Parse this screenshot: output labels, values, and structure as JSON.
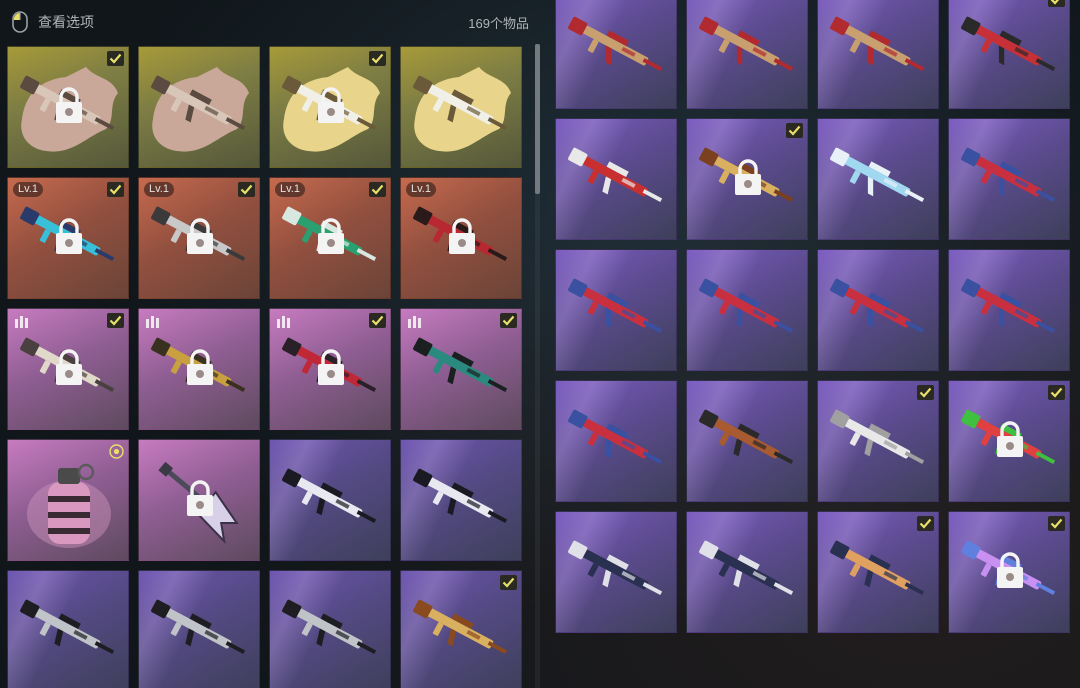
{
  "header": {
    "title": "查看选项",
    "count": "169个物品",
    "icon": "mouse-icon"
  },
  "colors": {
    "yellow": "#a79a39",
    "red": "#c66a4e",
    "pink": "#c77bc0",
    "purple": "#6d55b0",
    "check": "#e8e06a"
  },
  "left_items": [
    {
      "rarity": "yellow",
      "art": "rifle-cream",
      "splash": "#c9a89a",
      "locked": true,
      "checked": true
    },
    {
      "rarity": "yellow",
      "art": "rifle-cream",
      "splash": "#c9a89a",
      "locked": false,
      "checked": false
    },
    {
      "rarity": "yellow",
      "art": "rifle-white",
      "splash": "#e8d48a",
      "locked": true,
      "checked": true
    },
    {
      "rarity": "yellow",
      "art": "rifle-white",
      "splash": "#e8d48a",
      "locked": false,
      "checked": false
    },
    {
      "rarity": "red",
      "art": "smg-cyan",
      "level": "Lv.1",
      "locked": true,
      "checked": true
    },
    {
      "rarity": "red",
      "art": "rifle-gray",
      "level": "Lv.1",
      "locked": true,
      "checked": true
    },
    {
      "rarity": "red",
      "art": "rifle-green",
      "level": "Lv.1",
      "locked": true,
      "checked": true
    },
    {
      "rarity": "red",
      "art": "shotgun-red",
      "level": "Lv.1",
      "locked": true,
      "checked": false
    },
    {
      "rarity": "pink",
      "art": "rifle-bone",
      "tier": true,
      "locked": true,
      "checked": true
    },
    {
      "rarity": "pink",
      "art": "rifle-gold",
      "tier": true,
      "locked": true,
      "checked": false
    },
    {
      "rarity": "pink",
      "art": "rifle-red",
      "tier": true,
      "locked": true,
      "checked": true
    },
    {
      "rarity": "pink",
      "art": "rifle-teal",
      "tier": true,
      "locked": false,
      "checked": true
    },
    {
      "rarity": "pink",
      "art": "grenade-pink",
      "target": true,
      "locked": false,
      "checked": false
    },
    {
      "rarity": "pink",
      "art": "guitar-axe",
      "locked": true,
      "checked": false
    },
    {
      "rarity": "purple",
      "art": "scar-white",
      "locked": false,
      "checked": false
    },
    {
      "rarity": "purple",
      "art": "scar-white",
      "locked": false,
      "checked": false
    },
    {
      "rarity": "purple",
      "art": "scar-gray",
      "locked": false,
      "checked": false
    },
    {
      "rarity": "purple",
      "art": "scar-gray",
      "locked": false,
      "checked": false
    },
    {
      "rarity": "purple",
      "art": "scar-gray",
      "locked": false,
      "checked": false
    },
    {
      "rarity": "purple",
      "art": "groza-gold",
      "locked": false,
      "checked": true
    }
  ],
  "right_items": [
    {
      "rarity": "violet",
      "art": "akm-tan",
      "locked": false,
      "checked": false
    },
    {
      "rarity": "violet",
      "art": "akm-tan",
      "locked": false,
      "checked": false
    },
    {
      "rarity": "violet",
      "art": "akm-tan",
      "locked": false,
      "checked": false
    },
    {
      "rarity": "violet",
      "art": "akm-red",
      "locked": false,
      "checked": true
    },
    {
      "rarity": "violet",
      "art": "m4-red",
      "locked": false,
      "checked": false
    },
    {
      "rarity": "violet",
      "art": "akm-gold",
      "locked": true,
      "checked": true
    },
    {
      "rarity": "violet",
      "art": "akm-ice",
      "locked": false,
      "checked": false
    },
    {
      "rarity": "violet",
      "art": "akm-flag",
      "locked": false,
      "checked": false
    },
    {
      "rarity": "violet",
      "art": "akm-flag",
      "locked": false,
      "checked": false
    },
    {
      "rarity": "violet",
      "art": "akm-flag",
      "locked": false,
      "checked": false
    },
    {
      "rarity": "violet",
      "art": "akm-flag",
      "locked": false,
      "checked": false
    },
    {
      "rarity": "violet",
      "art": "akm-flag",
      "locked": false,
      "checked": false
    },
    {
      "rarity": "violet",
      "art": "akm-flag",
      "locked": false,
      "checked": false
    },
    {
      "rarity": "violet",
      "art": "beryl-wood",
      "locked": false,
      "checked": false
    },
    {
      "rarity": "violet",
      "art": "mini-white",
      "locked": false,
      "checked": true
    },
    {
      "rarity": "violet",
      "art": "m4-toy",
      "locked": true,
      "checked": true
    },
    {
      "rarity": "violet",
      "art": "m16-navy",
      "locked": false,
      "checked": false
    },
    {
      "rarity": "violet",
      "art": "m16-navy",
      "locked": false,
      "checked": false
    },
    {
      "rarity": "violet",
      "art": "slr-navy",
      "locked": false,
      "checked": true
    },
    {
      "rarity": "violet",
      "art": "m4-candy",
      "locked": true,
      "checked": true
    }
  ]
}
